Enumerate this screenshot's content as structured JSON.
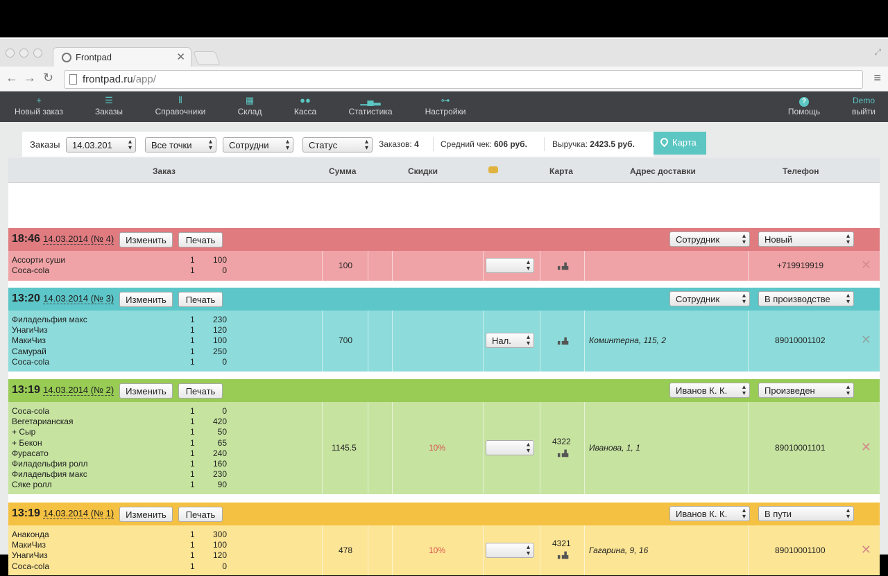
{
  "browser": {
    "tab_title": "Frontpad",
    "url_host": "frontpad.ru",
    "url_path": "/app/"
  },
  "toolbar": {
    "items": [
      {
        "label": "Новый заказ",
        "icon": "plus-icon",
        "glyph": "+"
      },
      {
        "label": "Заказы",
        "icon": "list-icon",
        "glyph": "☰"
      },
      {
        "label": "Справочники",
        "icon": "books-icon",
        "glyph": "⦀"
      },
      {
        "label": "Склад",
        "icon": "warehouse-icon",
        "glyph": "▦"
      },
      {
        "label": "Касса",
        "icon": "coins-icon",
        "glyph": "●●"
      },
      {
        "label": "Статистика",
        "icon": "bar-chart-icon",
        "glyph": "▁▄▂"
      },
      {
        "label": "Настройки",
        "icon": "settings-icon",
        "glyph": "⊶"
      }
    ],
    "help_label": "Помощь",
    "help_glyph": "?",
    "user_name": "Demo",
    "logout_label": "выйти"
  },
  "filters": {
    "orders_label": "Заказы",
    "date_value": "14.03.201",
    "points_value": "Все точки",
    "staff_value": "Сотрудни",
    "status_value": "Статус",
    "orders_count_label": "Заказов:",
    "orders_count": "4",
    "avg_check_label": "Средний чек:",
    "avg_check": "606 руб.",
    "revenue_label": "Выручка:",
    "revenue": "2423.5 руб.",
    "map_button": "Карта"
  },
  "table": {
    "headers": {
      "order": "Заказ",
      "sum": "Сумма",
      "discounts": "Скидки",
      "card": "Карта",
      "address": "Адрес доставки",
      "phone": "Телефон"
    }
  },
  "buttons": {
    "edit": "Изменить",
    "print": "Печать"
  },
  "orders": [
    {
      "time": "18:46",
      "date_num": "14.03.2014 (№ 4)",
      "staff": "Сотрудник",
      "status": "Новый",
      "sum": "100",
      "discount": "",
      "payment": "",
      "card": "",
      "address": "",
      "phone": "+719919919",
      "items": [
        {
          "name": "Ассорти суши",
          "qty": "1",
          "price": "100"
        },
        {
          "name": "Coca-cola",
          "qty": "1",
          "price": "0"
        }
      ]
    },
    {
      "time": "13:20",
      "date_num": "14.03.2014 (№ 3)",
      "staff": "Сотрудник",
      "status": "В производстве",
      "sum": "700",
      "discount": "",
      "payment": "Нал.",
      "card": "",
      "address": "Коминтерна, 115, 2",
      "phone": "89010001102",
      "items": [
        {
          "name": "Филадельфия макс",
          "qty": "1",
          "price": "230"
        },
        {
          "name": "УнагиЧиз",
          "qty": "1",
          "price": "120"
        },
        {
          "name": "МакиЧиз",
          "qty": "1",
          "price": "100"
        },
        {
          "name": "Самурай",
          "qty": "1",
          "price": "250"
        },
        {
          "name": "Coca-cola",
          "qty": "1",
          "price": "0"
        }
      ]
    },
    {
      "time": "13:19",
      "date_num": "14.03.2014 (№ 2)",
      "staff": "Иванов К. К.",
      "status": "Произведен",
      "sum": "1145.5",
      "discount": "10%",
      "payment": "",
      "card": "4322",
      "address": "Иванова, 1, 1",
      "phone": "89010001101",
      "items": [
        {
          "name": "Coca-cola",
          "qty": "1",
          "price": "0"
        },
        {
          "name": "Вегетарианская",
          "qty": "1",
          "price": "420"
        },
        {
          "name": "+ Сыр",
          "qty": "1",
          "price": "50"
        },
        {
          "name": "+ Бекон",
          "qty": "1",
          "price": "65"
        },
        {
          "name": "Фурасато",
          "qty": "1",
          "price": "240"
        },
        {
          "name": "Филадельфия ролл",
          "qty": "1",
          "price": "160"
        },
        {
          "name": "Филадельфия макс",
          "qty": "1",
          "price": "230"
        },
        {
          "name": "Сяке ролл",
          "qty": "1",
          "price": "90"
        }
      ]
    },
    {
      "time": "13:19",
      "date_num": "14.03.2014 (№ 1)",
      "staff": "Иванов К. К.",
      "status": "В пути",
      "sum": "478",
      "discount": "10%",
      "payment": "",
      "card": "4321",
      "address": "Гагарина, 9, 16",
      "phone": "89010001100",
      "items": [
        {
          "name": "Анаконда",
          "qty": "1",
          "price": "300"
        },
        {
          "name": "МакиЧиз",
          "qty": "1",
          "price": "100"
        },
        {
          "name": "УнагиЧиз",
          "qty": "1",
          "price": "120"
        },
        {
          "name": "Coca-cola",
          "qty": "1",
          "price": "0"
        }
      ]
    }
  ],
  "colors": {
    "toolbar_bg": "#3f4145",
    "accent": "#5cc6c2",
    "status_new_head": "#e07b80",
    "status_new_body": "#f0a3a6",
    "status_production_head": "#5cc6c8",
    "status_production_body": "#8ddcdb",
    "status_done_head": "#98cc55",
    "status_done_body": "#c6e3a0",
    "status_transit_head": "#f5c142",
    "status_transit_body": "#fce595"
  }
}
